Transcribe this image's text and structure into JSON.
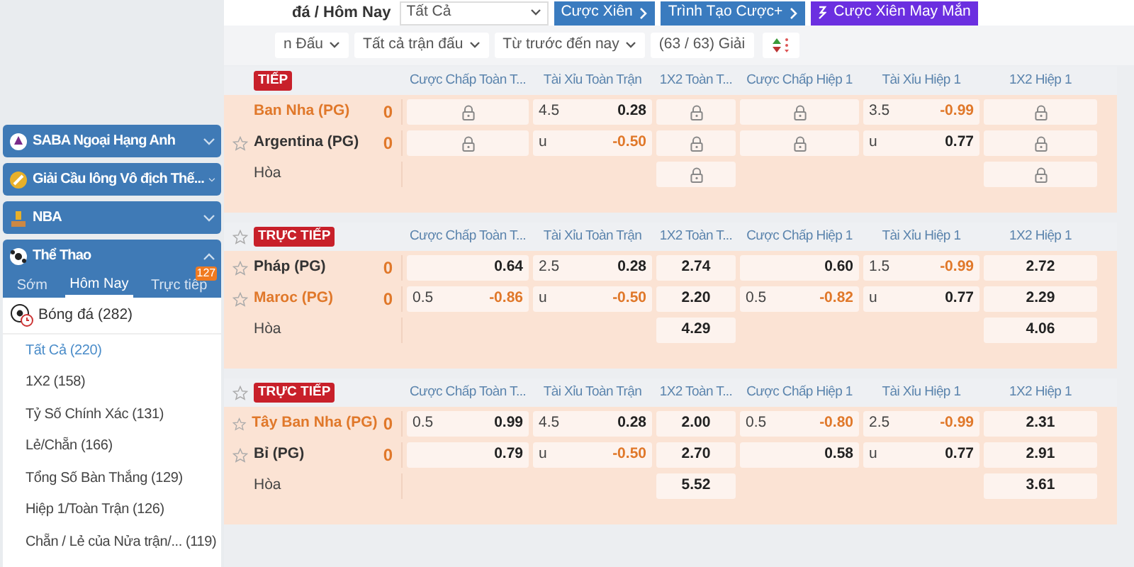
{
  "toolbar": {
    "breadcrumb": "đá / Hôm Nay",
    "market_select": "Tất Cả",
    "buttons": [
      {
        "label": "Cược Xiên",
        "kind": "blue"
      },
      {
        "label": "Trình Tạo Cược+",
        "kind": "blue"
      },
      {
        "label": "Cược Xiên May Mắn",
        "kind": "purple"
      }
    ]
  },
  "filters": [
    {
      "label": "n Đấu",
      "kind": "dropdown"
    },
    {
      "label": "Tất cả trận đấu",
      "kind": "dropdown"
    },
    {
      "label": "Từ trước đến nay",
      "kind": "dropdown"
    },
    {
      "label": "(63 / 63) Giải",
      "kind": "plain"
    },
    {
      "kind": "sort"
    }
  ],
  "sidebar": {
    "leagues": [
      {
        "label": "SABA Ngoại Hạng Anh",
        "expanded": false
      },
      {
        "label": "Giải Cầu lông Vô địch Thế...",
        "expanded": false
      },
      {
        "label": "NBA",
        "expanded": false
      },
      {
        "label": "Thể Thao",
        "expanded": true
      }
    ],
    "tabs": [
      {
        "label": "Sớm",
        "selected": false
      },
      {
        "label": "Hôm Nay",
        "selected": true
      },
      {
        "label": "Trực tiếp",
        "selected": false,
        "badge": "127"
      }
    ],
    "sport": {
      "label": "Bóng đá",
      "count": "(282)"
    },
    "markets": [
      {
        "label": "Tất Cả",
        "count": "(220)",
        "selected": true
      },
      {
        "label": "1X2",
        "count": "(158)",
        "selected": false
      },
      {
        "label": "Tỷ Số Chính Xác",
        "count": "(131)",
        "selected": false
      },
      {
        "label": "Lẻ/Chẵn",
        "count": "(166)",
        "selected": false
      },
      {
        "label": "Tổng Số Bàn Thắng",
        "count": "(129)",
        "selected": false
      },
      {
        "label": "Hiệp 1/Toàn Trận",
        "count": "(126)",
        "selected": false
      },
      {
        "label": "Chẵn / Lẻ của Nửa trận/...",
        "count": "(119)",
        "selected": false
      }
    ]
  },
  "matches": [
    {
      "live_label": "TIẾP",
      "favorite_icon": false,
      "columns": [
        "Cược Chấp Toàn T...",
        "Tài Xỉu Toàn Trận",
        "1X2 Toàn T...",
        "Cược Chấp Hiệp 1",
        "Tài Xỉu Hiệp 1",
        "1X2 Hiệp 1"
      ],
      "rows": [
        {
          "team": "Ban Nha (PG)",
          "score": "0",
          "highlighted": true,
          "favorite_icon": false,
          "cells": [
            {
              "kind": "lock"
            },
            {
              "kind": "odds",
              "line": "4.5",
              "price": "0.28",
              "negative": false
            },
            {
              "kind": "lock"
            },
            {
              "kind": "lock"
            },
            {
              "kind": "odds",
              "line": "3.5",
              "price": "-0.99",
              "negative": true
            },
            {
              "kind": "lock"
            }
          ]
        },
        {
          "team": "Argentina (PG)",
          "score": "0",
          "highlighted": false,
          "favorite_icon": true,
          "cells": [
            {
              "kind": "lock"
            },
            {
              "kind": "odds",
              "line": "u",
              "price": "-0.50",
              "negative": true
            },
            {
              "kind": "lock"
            },
            {
              "kind": "lock"
            },
            {
              "kind": "odds",
              "line": "u",
              "price": "0.77",
              "negative": false
            },
            {
              "kind": "lock"
            }
          ]
        },
        {
          "draw": "Hòa",
          "cells": [
            {
              "kind": "empty"
            },
            {
              "kind": "empty"
            },
            {
              "kind": "lock"
            },
            {
              "kind": "empty"
            },
            {
              "kind": "empty"
            },
            {
              "kind": "lock"
            }
          ]
        }
      ]
    },
    {
      "live_label": "TRỰC TIẾP",
      "favorite_icon": true,
      "columns": [
        "Cược Chấp Toàn T...",
        "Tài Xỉu Toàn Trận",
        "1X2 Toàn T...",
        "Cược Chấp Hiệp 1",
        "Tài Xỉu Hiệp 1",
        "1X2 Hiệp 1"
      ],
      "rows": [
        {
          "team": "Pháp (PG)",
          "score": "0",
          "highlighted": false,
          "favorite_icon": true,
          "cells": [
            {
              "kind": "odds",
              "price": "0.64",
              "negative": false
            },
            {
              "kind": "odds",
              "line": "2.5",
              "price": "0.28",
              "negative": false
            },
            {
              "kind": "price",
              "price": "2.74"
            },
            {
              "kind": "odds",
              "price": "0.60",
              "negative": false
            },
            {
              "kind": "odds",
              "line": "1.5",
              "price": "-0.99",
              "negative": true
            },
            {
              "kind": "price",
              "price": "2.72"
            }
          ]
        },
        {
          "team": "Maroc (PG)",
          "score": "0",
          "highlighted": true,
          "favorite_icon": true,
          "cells": [
            {
              "kind": "odds",
              "line": "0.5",
              "price": "-0.86",
              "negative": true
            },
            {
              "kind": "odds",
              "line": "u",
              "price": "-0.50",
              "negative": true
            },
            {
              "kind": "price",
              "price": "2.20"
            },
            {
              "kind": "odds",
              "line": "0.5",
              "price": "-0.82",
              "negative": true
            },
            {
              "kind": "odds",
              "line": "u",
              "price": "0.77",
              "negative": false
            },
            {
              "kind": "price",
              "price": "2.29"
            }
          ]
        },
        {
          "draw": "Hòa",
          "cells": [
            {
              "kind": "empty"
            },
            {
              "kind": "empty"
            },
            {
              "kind": "price",
              "price": "4.29"
            },
            {
              "kind": "empty"
            },
            {
              "kind": "empty"
            },
            {
              "kind": "price",
              "price": "4.06"
            }
          ]
        }
      ]
    },
    {
      "live_label": "TRỰC TIẾP",
      "favorite_icon": true,
      "columns": [
        "Cược Chấp Toàn T...",
        "Tài Xỉu Toàn Trận",
        "1X2 Toàn T...",
        "Cược Chấp Hiệp 1",
        "Tài Xỉu Hiệp 1",
        "1X2 Hiệp 1"
      ],
      "rows": [
        {
          "team": "Tây Ban Nha (PG)",
          "score": "0",
          "highlighted": true,
          "favorite_icon": true,
          "cells": [
            {
              "kind": "odds",
              "line": "0.5",
              "price": "0.99",
              "negative": false
            },
            {
              "kind": "odds",
              "line": "4.5",
              "price": "0.28",
              "negative": false
            },
            {
              "kind": "price",
              "price": "2.00"
            },
            {
              "kind": "odds",
              "line": "0.5",
              "price": "-0.80",
              "negative": true
            },
            {
              "kind": "odds",
              "line": "2.5",
              "price": "-0.99",
              "negative": true
            },
            {
              "kind": "price",
              "price": "2.31"
            }
          ]
        },
        {
          "team": "Bỉ (PG)",
          "score": "0",
          "highlighted": false,
          "favorite_icon": true,
          "cells": [
            {
              "kind": "odds",
              "price": "0.79",
              "negative": false
            },
            {
              "kind": "odds",
              "line": "u",
              "price": "-0.50",
              "negative": true
            },
            {
              "kind": "price",
              "price": "2.70"
            },
            {
              "kind": "odds",
              "price": "0.58",
              "negative": false
            },
            {
              "kind": "odds",
              "line": "u",
              "price": "0.77",
              "negative": false
            },
            {
              "kind": "price",
              "price": "2.91"
            }
          ]
        },
        {
          "draw": "Hòa",
          "cells": [
            {
              "kind": "empty"
            },
            {
              "kind": "empty"
            },
            {
              "kind": "price",
              "price": "5.52"
            },
            {
              "kind": "empty"
            },
            {
              "kind": "empty"
            },
            {
              "kind": "price",
              "price": "3.61"
            }
          ]
        }
      ]
    }
  ]
}
